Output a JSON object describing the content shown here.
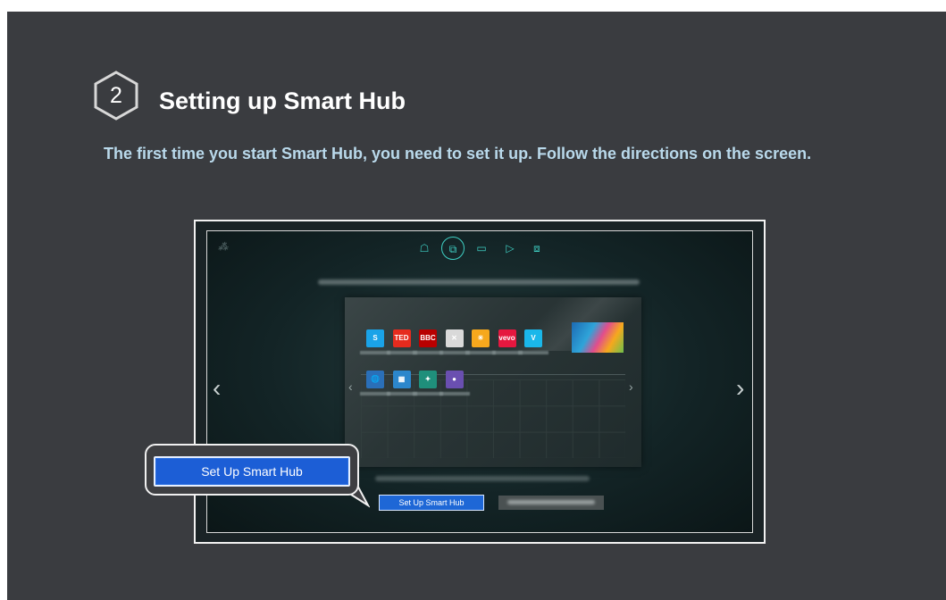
{
  "step": {
    "number": "2",
    "title": "Setting up Smart Hub"
  },
  "description": "The first time you start Smart Hub, you need to set it up. Follow the directions on the screen.",
  "tv_screen": {
    "topbar_icons": [
      "games-icon",
      "apps-icon",
      "tv-icon",
      "play-icon",
      "multiscreen-icon"
    ],
    "apps_row1": [
      {
        "name": "skype-icon",
        "text": "S",
        "color": "#1aa3e8"
      },
      {
        "name": "ted-icon",
        "text": "TED",
        "color": "#e62b1e"
      },
      {
        "name": "bbc-news-icon",
        "text": "BBC",
        "color": "#b80000"
      },
      {
        "name": "game-icon",
        "text": "✕",
        "color": "#d9d9d9"
      },
      {
        "name": "sun-icon",
        "text": "☀",
        "color": "#f6a81d"
      },
      {
        "name": "vevo-icon",
        "text": "vevo",
        "color": "#e5173f"
      },
      {
        "name": "vimeo-icon",
        "text": "V",
        "color": "#1ab7ea"
      }
    ],
    "apps_row2": [
      {
        "name": "web-browser-icon",
        "text": "🌐",
        "color": "#2a6fb8"
      },
      {
        "name": "social-icon",
        "text": "▦",
        "color": "#2c87cc"
      },
      {
        "name": "fitness-icon",
        "text": "✦",
        "color": "#1f8f7b"
      },
      {
        "name": "camera-icon",
        "text": "●",
        "color": "#6a4fb0"
      }
    ],
    "setup_button_label": "Set Up Smart Hub"
  },
  "callout": {
    "button_label": "Set Up Smart Hub"
  },
  "colors": {
    "background": "#3a3c40",
    "accent": "#1c5ed6",
    "desc_text": "#b9d9eb"
  }
}
